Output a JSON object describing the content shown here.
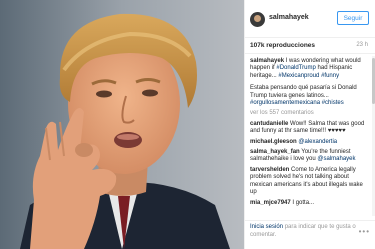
{
  "post": {
    "username": "salmahayek",
    "follow_label": "Seguir",
    "views": "107k reproducciones",
    "time_ago": "23 h",
    "more_icon": "more-horizontal-icon"
  },
  "caption": {
    "user": "salmahayek",
    "text_en": "I was wondering what would happen if",
    "tag1": "#DonaldTrump",
    "text_en2": "had Hispanic heritage...",
    "tag2": "#Mexicanproud",
    "tag3": "#funny",
    "text_es": "Estaba pensando qué pasaría si Donald Trump tuviera genes latinos...",
    "tag4": "#orgullosamentemexicana",
    "tag5": "#chistes"
  },
  "comments_link": "ver los 557 comentarios",
  "comments": [
    {
      "user": "cantudanielle",
      "text": "Wow!! Salma that was good and funny at thr same time!!!",
      "extra": "♥♥♥♥♥"
    },
    {
      "user": "michael.gleeson",
      "mention": "@alexandertia",
      "text": ""
    },
    {
      "user": "salma_hayek_fan",
      "text": "You're the funniest salmathehaike i love you",
      "mention": "@salmahayek"
    },
    {
      "user": "tarvershelden",
      "text": "Come to America legally problem solved he's not talking about mexican americans it's about illegals wake up"
    },
    {
      "user": "mia_mjce7947",
      "text": "I gotta..."
    }
  ],
  "footer": {
    "login_link": "Inicia sesión",
    "login_rest": "para indicar que te gusta o comentar."
  },
  "colors": {
    "accent": "#3897f0",
    "hashtag": "#003569"
  }
}
